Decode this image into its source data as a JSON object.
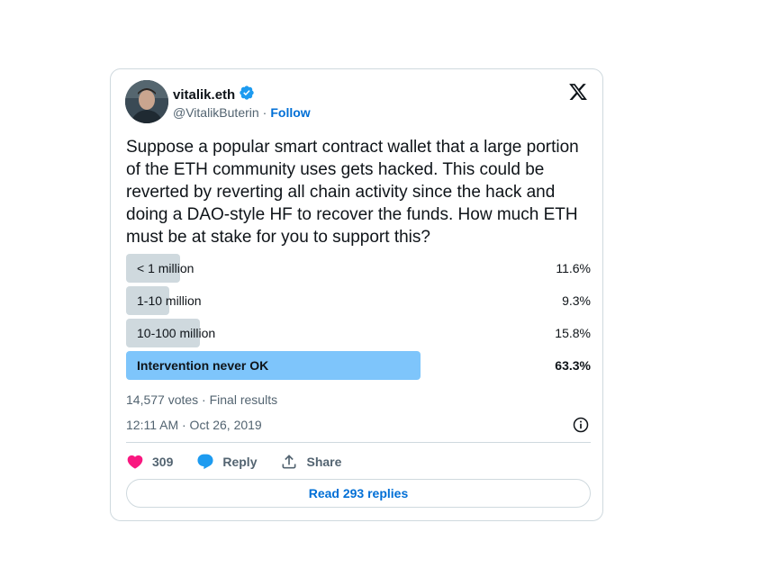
{
  "author": {
    "name": "vitalik.eth",
    "handle": "@VitalikButerin",
    "separator": "·",
    "follow_label": "Follow",
    "verified_color": "#1d9bf0"
  },
  "tweet_text": "Suppose a popular smart contract wallet that a large portion of the ETH community uses gets hacked. This could be reverted by reverting all chain activity since the hack and doing a DAO-style HF to recover the funds. How much ETH must be at stake for you to support this?",
  "poll": {
    "options": [
      {
        "label": "< 1 million",
        "percent_text": "11.6%",
        "percent": 11.6,
        "winner": false
      },
      {
        "label": "1-10 million",
        "percent_text": "9.3%",
        "percent": 9.3,
        "winner": false
      },
      {
        "label": "10-100 million",
        "percent_text": "15.8%",
        "percent": 15.8,
        "winner": false
      },
      {
        "label": "Intervention never OK",
        "percent_text": "63.3%",
        "percent": 63.3,
        "winner": true
      }
    ],
    "summary": "14,577 votes · Final results"
  },
  "timestamp": "12:11 AM · Oct 26, 2019",
  "actions": {
    "like_count": "309",
    "reply_label": "Reply",
    "share_label": "Share",
    "like_color": "#f91880",
    "reply_color": "#1d9bf0"
  },
  "read_replies_label": "Read 293 replies",
  "icons": [
    "verified-badge-icon",
    "x-logo-icon",
    "info-icon",
    "heart-icon",
    "reply-bubble-icon",
    "share-icon"
  ]
}
